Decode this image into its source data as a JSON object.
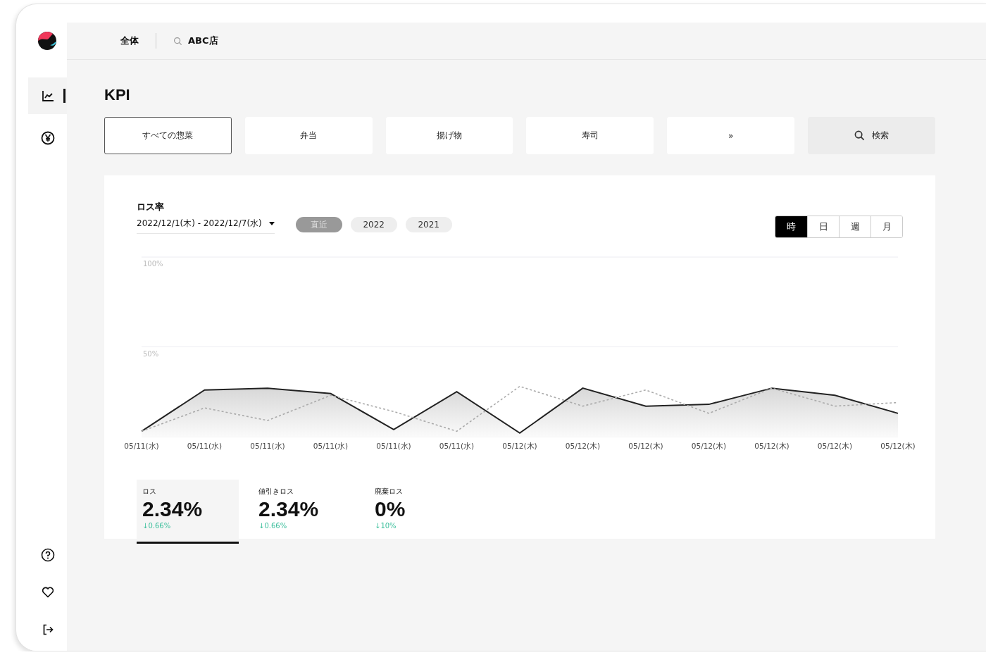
{
  "topbar": {
    "scope": "全体",
    "store": "ABC店"
  },
  "sidebar": {
    "items": [
      {
        "selected": true
      },
      {
        "selected": false
      }
    ]
  },
  "page_title": "KPI",
  "categories": [
    {
      "label": "すべての惣菜",
      "selected": true
    },
    {
      "label": "弁当",
      "selected": false
    },
    {
      "label": "揚げ物",
      "selected": false
    },
    {
      "label": "寿司",
      "selected": false
    },
    {
      "label": "»",
      "selected": false
    }
  ],
  "search_button": "検索",
  "card": {
    "title": "ロス率",
    "date_range": "2022/12/1(木) - 2022/12/7(水)",
    "periods": [
      {
        "label": "直近",
        "selected": true
      },
      {
        "label": "2022",
        "selected": false
      },
      {
        "label": "2021",
        "selected": false
      }
    ],
    "granularity": [
      {
        "label": "時",
        "selected": true
      },
      {
        "label": "日",
        "selected": false
      },
      {
        "label": "週",
        "selected": false
      },
      {
        "label": "月",
        "selected": false
      }
    ],
    "chart_data": {
      "type": "line",
      "categories": [
        "05/11(水)",
        "05/11(水)",
        "05/11(水)",
        "05/11(水)",
        "05/11(水)",
        "05/11(水)",
        "05/12(木)",
        "05/12(木)",
        "05/12(木)",
        "05/12(木)",
        "05/12(木)",
        "05/12(木)",
        "05/12(木)"
      ],
      "yticks": [
        {
          "value": 50,
          "label": "50%"
        },
        {
          "value": 100,
          "label": "100%"
        }
      ],
      "ylim": [
        0,
        100
      ],
      "series": [
        {
          "color": "#222222",
          "line_style": "solid",
          "values": [
            3,
            26,
            27,
            24,
            4,
            25,
            2,
            27,
            17,
            18,
            27,
            23,
            13
          ]
        },
        {
          "color": "#aaaaaa",
          "line_style": "dotted",
          "values": [
            3,
            16,
            9,
            23,
            14,
            3,
            28,
            17,
            26,
            13,
            27,
            17,
            19
          ]
        }
      ]
    },
    "metrics": [
      {
        "label": "ロス",
        "value": "2.34%",
        "delta": "↓0.66%",
        "selected": true
      },
      {
        "label": "値引きロス",
        "value": "2.34%",
        "delta": "↓0.66%",
        "selected": false
      },
      {
        "label": "廃棄ロス",
        "value": "0%",
        "delta": "↓10%",
        "selected": false
      }
    ]
  }
}
